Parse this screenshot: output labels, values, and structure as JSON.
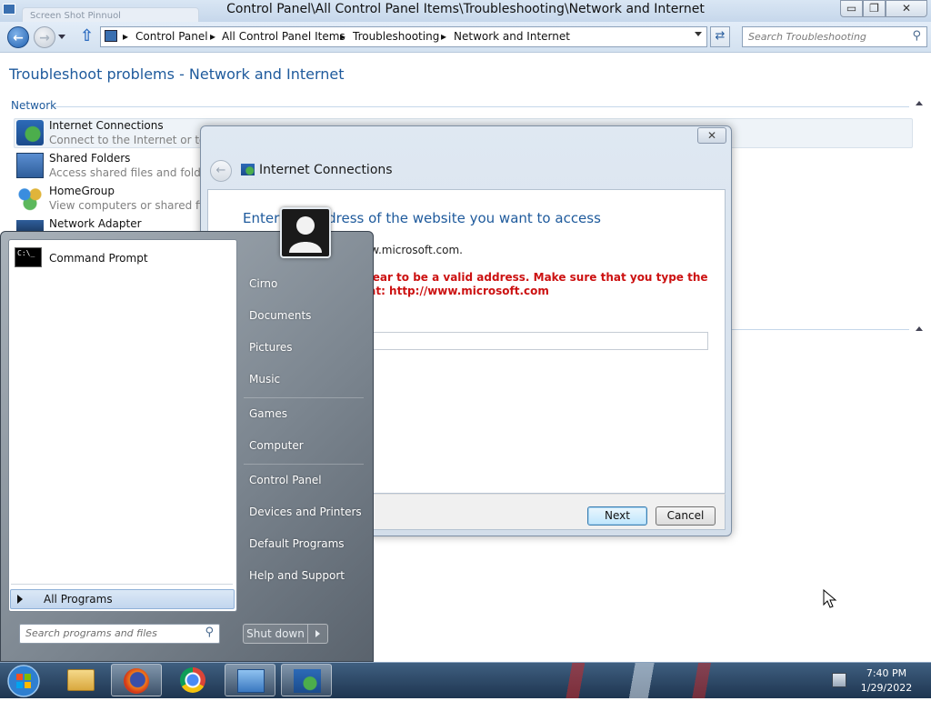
{
  "window": {
    "title": "Control Panel\\All Control Panel Items\\Troubleshooting\\Network and Internet",
    "ghost_tab": "Screen Shot Pinnuol",
    "minimize": "▭",
    "maximize": "❐",
    "close": "✕"
  },
  "address_bar": {
    "crumbs": [
      "Control Panel",
      "All Control Panel Items",
      "Troubleshooting",
      "Network and Internet"
    ],
    "search_placeholder": "Search Troubleshooting"
  },
  "page": {
    "heading": "Troubleshoot problems - Network and Internet",
    "section": "Network",
    "items": [
      {
        "name": "Internet Connections",
        "desc": "Connect to the Internet or to a particular website"
      },
      {
        "name": "Shared Folders",
        "desc": "Access shared files and folders on other computers"
      },
      {
        "name": "HomeGroup",
        "desc": "View computers or shared files in a homegroup"
      },
      {
        "name": "Network Adapter",
        "desc": ""
      }
    ]
  },
  "dialog": {
    "title": "Internet Connections",
    "heading": "Enter the address of the website you want to access",
    "example": "For example, http://www.microsoft.com.",
    "error": "\"https\" does not appear to be a valid address. Make sure that you type the address in this format: http://www.microsoft.com",
    "input_value": "",
    "next": "Next",
    "cancel": "Cancel"
  },
  "start_menu": {
    "pinned": [
      "Command Prompt"
    ],
    "all_programs": "All Programs",
    "search_placeholder": "Search programs and files",
    "right": [
      "Cirno",
      "Documents",
      "Pictures",
      "Music",
      "Games",
      "Computer",
      "Control Panel",
      "Devices and Printers",
      "Default Programs",
      "Help and Support"
    ],
    "shutdown": "Shut down"
  },
  "taskbar": {
    "apps": [
      "windows-explorer",
      "firefox",
      "chrome",
      "control-panel",
      "internet-connections-troubleshooter"
    ],
    "time": "7:40 PM",
    "date": "1/29/2022"
  },
  "colors": {
    "link_blue": "#1e5a9c",
    "error_red": "#cc1111",
    "taskbar": "#1e3550"
  }
}
